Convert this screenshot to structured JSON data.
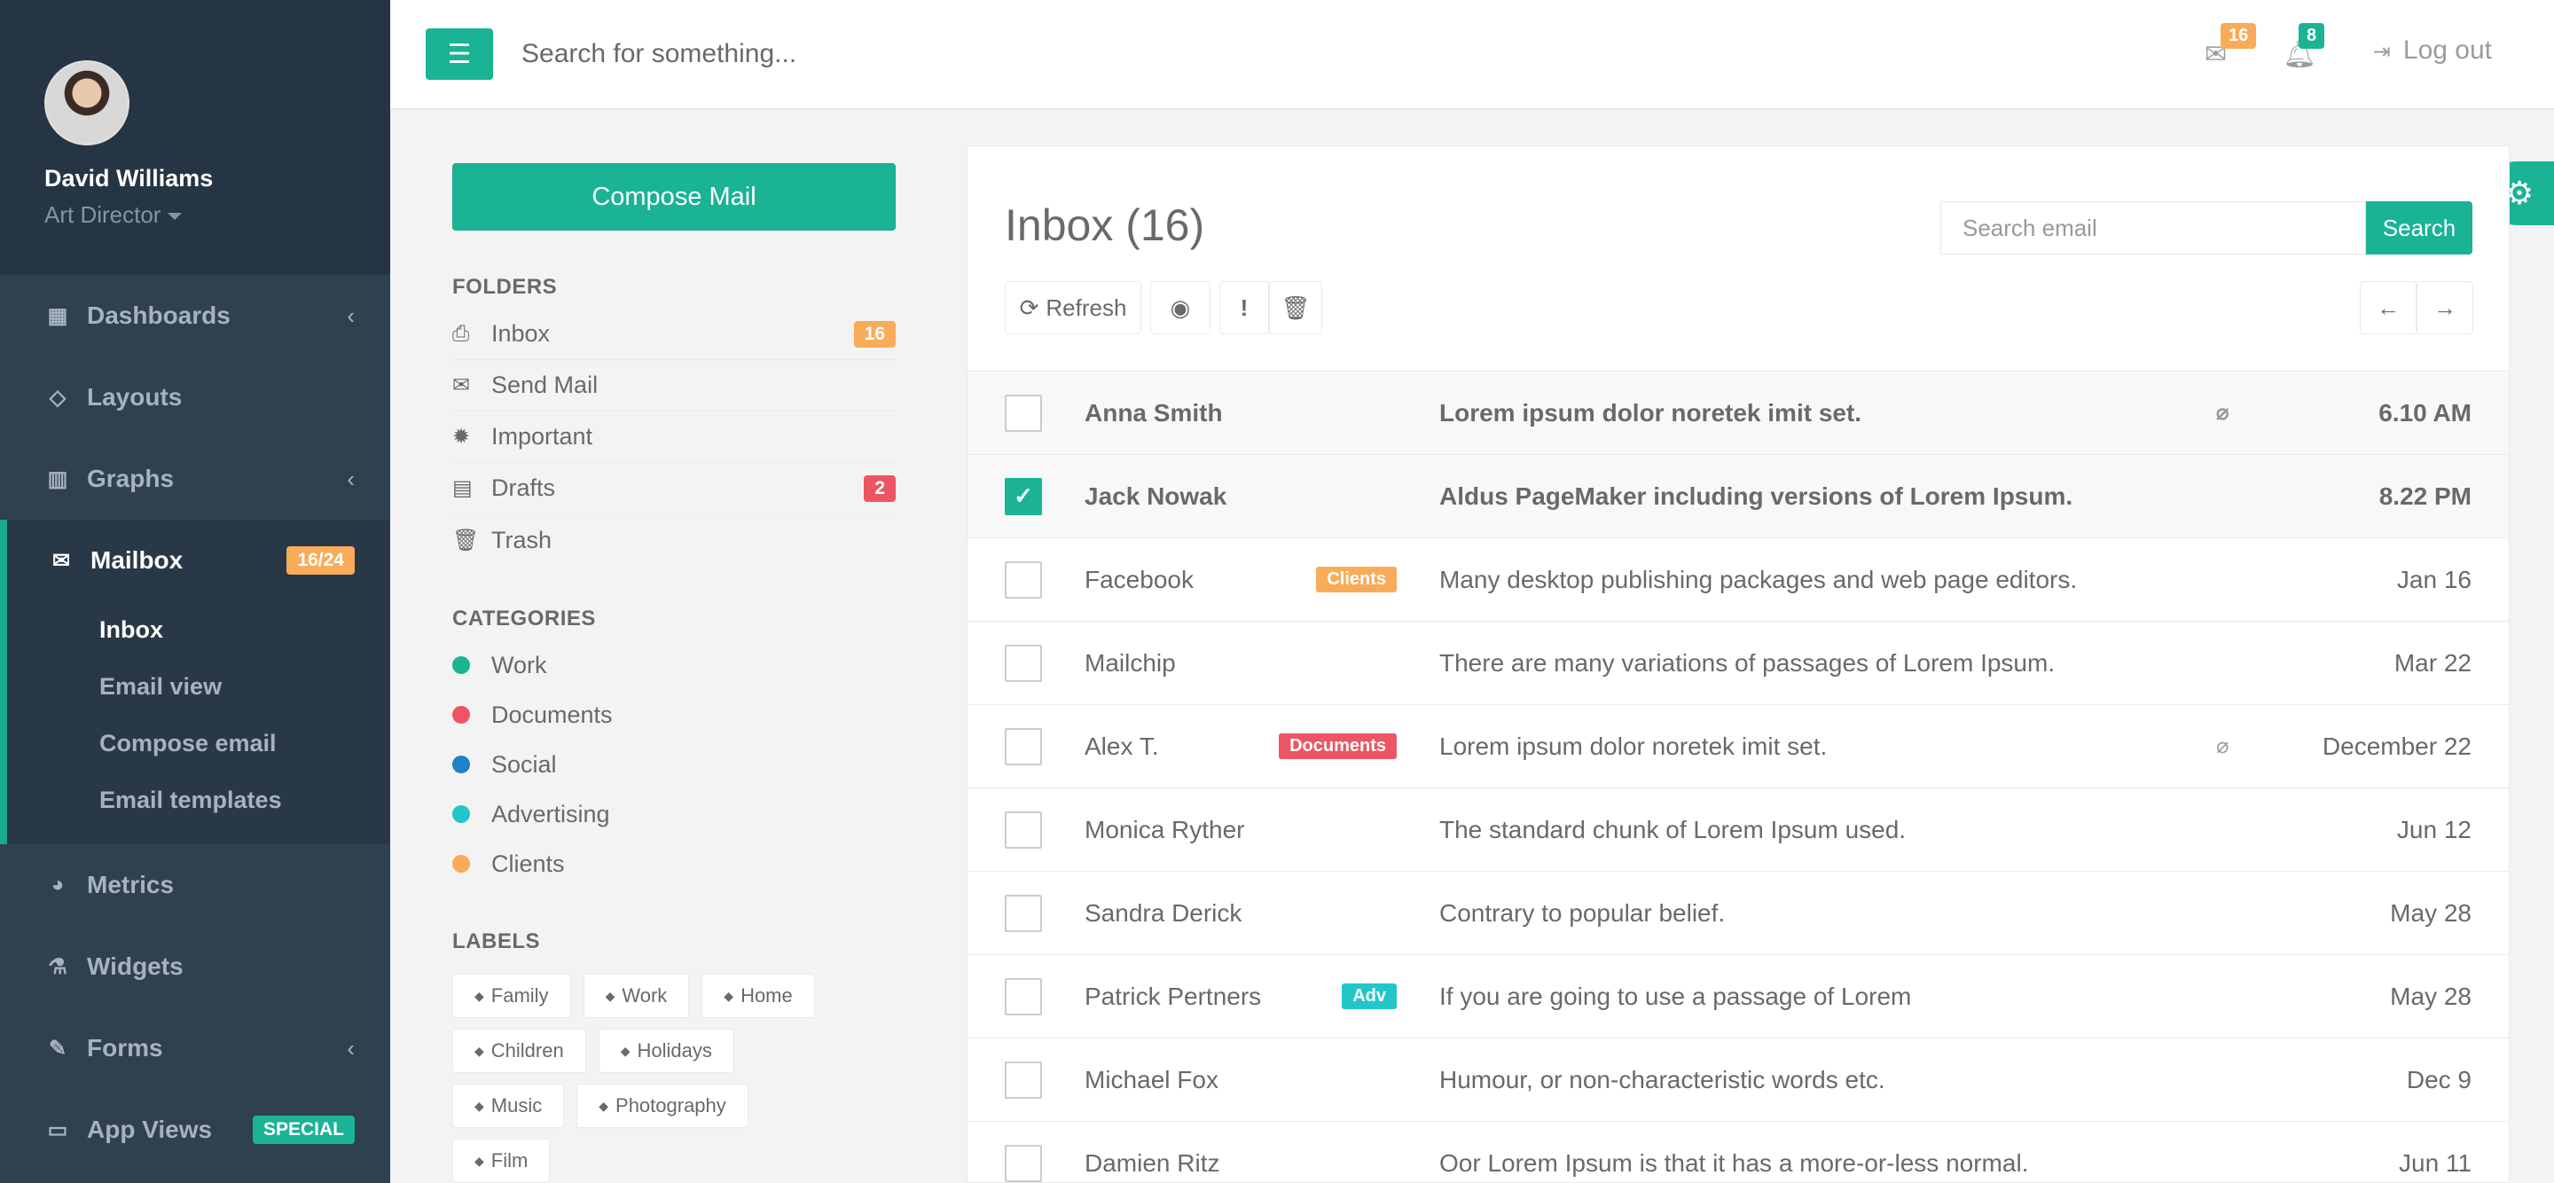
{
  "colors": {
    "primary": "#1ab394",
    "warning": "#f8ac59",
    "danger": "#ed5565",
    "info": "#23c6c8",
    "navy": "#2f4050",
    "blue": "#1c84c6"
  },
  "profile": {
    "name": "David Williams",
    "role": "Art Director"
  },
  "sidebar": {
    "items": [
      {
        "icon": "dashboard-icon",
        "glyph": "▦",
        "label": "Dashboards"
      },
      {
        "icon": "diamond-icon",
        "glyph": "◇",
        "label": "Layouts"
      },
      {
        "icon": "bar-chart-icon",
        "glyph": "▥",
        "label": "Graphs"
      },
      {
        "icon": "envelope-icon",
        "glyph": "✉",
        "label": "Mailbox",
        "badge": "16/24"
      },
      {
        "icon": "pie-chart-icon",
        "glyph": "◕",
        "label": "Metrics"
      },
      {
        "icon": "flask-icon",
        "glyph": "⚗",
        "label": "Widgets"
      },
      {
        "icon": "edit-icon",
        "glyph": "✎",
        "label": "Forms"
      },
      {
        "icon": "desktop-icon",
        "glyph": "▭",
        "label": "App Views",
        "badge": "SPECIAL"
      }
    ],
    "mailbox_sub": [
      "Inbox",
      "Email view",
      "Compose email",
      "Email templates"
    ]
  },
  "topbar": {
    "search_placeholder": "Search for something...",
    "mail_count": "16",
    "alert_count": "8",
    "logout_label": "Log out"
  },
  "folders_panel": {
    "compose_label": "Compose Mail",
    "folders_title": "FOLDERS",
    "folders": [
      {
        "icon": "inbox-icon",
        "glyph": "⎙",
        "label": "Inbox",
        "badge": "16"
      },
      {
        "icon": "envelope-o-icon",
        "glyph": "✉",
        "label": "Send Mail"
      },
      {
        "icon": "certificate-icon",
        "glyph": "✹",
        "label": "Important"
      },
      {
        "icon": "file-icon",
        "glyph": "▤",
        "label": "Drafts",
        "badge": "2"
      },
      {
        "icon": "trash-icon",
        "glyph": "🗑",
        "label": "Trash"
      }
    ],
    "categories_title": "CATEGORIES",
    "categories": [
      {
        "label": "Work",
        "color": "#1ab394"
      },
      {
        "label": "Documents",
        "color": "#ed5565"
      },
      {
        "label": "Social",
        "color": "#1c84c6"
      },
      {
        "label": "Advertising",
        "color": "#23c6c8"
      },
      {
        "label": "Clients",
        "color": "#f8ac59"
      }
    ],
    "labels_title": "LABELS",
    "labels": [
      "Family",
      "Work",
      "Home",
      "Children",
      "Holidays",
      "Music",
      "Photography",
      "Film"
    ]
  },
  "mail": {
    "title": "Inbox (16)",
    "search_placeholder": "Search email",
    "search_button": "Search",
    "refresh_label": "Refresh",
    "rows": [
      {
        "sender": "Anna Smith",
        "subject": "Lorem ipsum dolor noretek imit set.",
        "date": "6.10 AM",
        "unread": true,
        "checked": false,
        "attach": true
      },
      {
        "sender": "Jack Nowak",
        "subject": "Aldus PageMaker including versions of Lorem Ipsum.",
        "date": "8.22 PM",
        "unread": true,
        "checked": true,
        "attach": false
      },
      {
        "sender": "Facebook",
        "subject": "Many desktop publishing packages and web page editors.",
        "date": "Jan 16",
        "unread": false,
        "checked": false,
        "attach": false,
        "tag": "Clients",
        "tag_color": "#f8ac59"
      },
      {
        "sender": "Mailchip",
        "subject": "There are many variations of passages of Lorem Ipsum.",
        "date": "Mar 22",
        "unread": false,
        "checked": false,
        "attach": false
      },
      {
        "sender": "Alex T.",
        "subject": "Lorem ipsum dolor noretek imit set.",
        "date": "December 22",
        "unread": false,
        "checked": false,
        "attach": true,
        "tag": "Documents",
        "tag_color": "#ed5565"
      },
      {
        "sender": "Monica Ryther",
        "subject": "The standard chunk of Lorem Ipsum used.",
        "date": "Jun 12",
        "unread": false,
        "checked": false,
        "attach": false
      },
      {
        "sender": "Sandra Derick",
        "subject": "Contrary to popular belief.",
        "date": "May 28",
        "unread": false,
        "checked": false,
        "attach": false
      },
      {
        "sender": "Patrick Pertners",
        "subject": "If you are going to use a passage of Lorem",
        "date": "May 28",
        "unread": false,
        "checked": false,
        "attach": false,
        "tag": "Adv",
        "tag_color": "#23c6c8"
      },
      {
        "sender": "Michael Fox",
        "subject": "Humour, or non-characteristic words etc.",
        "date": "Dec 9",
        "unread": false,
        "checked": false,
        "attach": false
      },
      {
        "sender": "Damien Ritz",
        "subject": "Oor Lorem Ipsum is that it has a more-or-less normal.",
        "date": "Jun 11",
        "unread": false,
        "checked": false,
        "attach": false
      }
    ]
  }
}
